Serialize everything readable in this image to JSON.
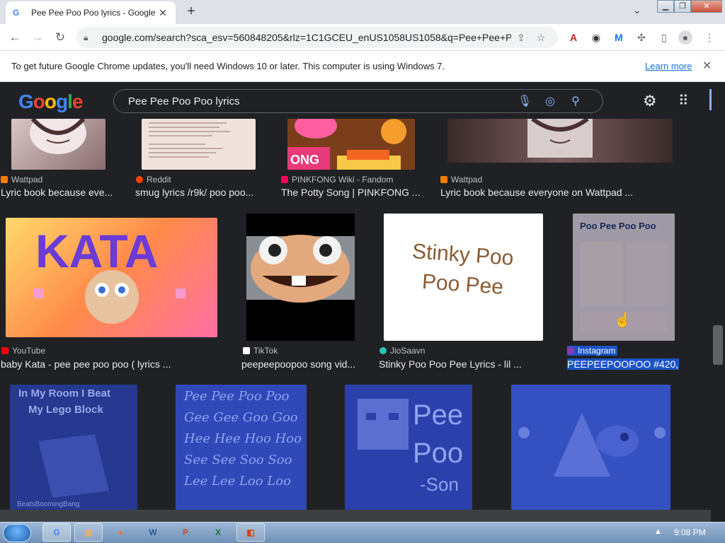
{
  "browser": {
    "tab_title": "Pee Pee Poo Poo lyrics - Google S",
    "tab_close": "✕",
    "new_tab": "+",
    "url": "google.com/search?sca_esv=560848205&rlz=1C1GCEU_enUS1058US1058&q=Pee+Pee+Po..."
  },
  "infobar": {
    "message": "To get future Google Chrome updates, you'll need Windows 10 or later. This computer is using Windows 7.",
    "learn_more": "Learn more",
    "close": "✕"
  },
  "google": {
    "logo": "Google",
    "query": "Pee Pee Poo Poo lyrics"
  },
  "results_row1": [
    {
      "source": "Wattpad",
      "title": "Lyric book because eve..."
    },
    {
      "source": "Reddit",
      "title": "smug lyrics /r9k/ poo poo..."
    },
    {
      "source": "PINKFONG Wiki - Fandom",
      "title": "The Potty Song | PINKFONG ..."
    },
    {
      "source": "Wattpad",
      "title": "Lyric book because everyone on Wattpad ..."
    }
  ],
  "results_row2": [
    {
      "source": "YouTube",
      "title": "baby Kata - pee pee poo poo ( lyrics ...",
      "image_text": "KATA"
    },
    {
      "source": "TikTok",
      "title": "peepeepoopoo song vid..."
    },
    {
      "source": "JioSaavn",
      "title": "Stinky Poo Poo Pee Lyrics - lil ...",
      "image_text_1": "Stinky Poo",
      "image_text_2": "Poo Pee"
    },
    {
      "source": "Instagram",
      "title": "PEEPEEPOOPOO #420,...",
      "image_text": "Poo Pee Poo Poo"
    }
  ],
  "results_row3": [
    {
      "image_text_1": "In My Room I Beat",
      "image_text_2": "My Lego Block",
      "image_text_3": "BeatsBoomingBang"
    },
    {
      "image_lines": [
        "Pee Pee Poo Poo",
        "Gee Gee Goo Goo",
        "Hee Hee Hoo Hoo",
        "See See Soo Soo",
        "Lee Lee Loo Loo"
      ]
    },
    {
      "image_text_1": "Pee I",
      "image_text_2": "Poo I",
      "image_text_3": "-Son"
    },
    {}
  ],
  "taskbar": {
    "clock": "9:08 PM"
  },
  "colors": {
    "page_bg": "#202124",
    "link_blue": "#1a73e8",
    "selection": "#1a53c5"
  }
}
